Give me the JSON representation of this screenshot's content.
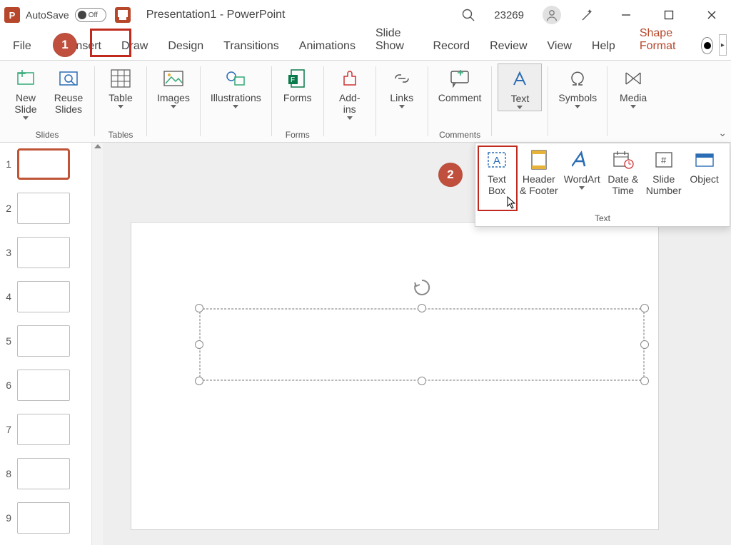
{
  "titlebar": {
    "autosave_label": "AutoSave",
    "autosave_state": "Off",
    "document_title": "Presentation1 - PowerPoint",
    "account": "23269"
  },
  "tabs": {
    "file": "File",
    "insert": "Insert",
    "draw": "Draw",
    "design": "Design",
    "transitions": "Transitions",
    "animations": "Animations",
    "slideshow": "Slide Show",
    "record": "Record",
    "review": "Review",
    "view": "View",
    "help": "Help",
    "shape_format": "Shape Format"
  },
  "ribbon": {
    "slides_group": "Slides",
    "new_slide": "New\nSlide",
    "reuse_slides": "Reuse\nSlides",
    "tables_group": "Tables",
    "table": "Table",
    "images": "Images",
    "illustrations": "Illustrations",
    "forms_group": "Forms",
    "forms": "Forms",
    "addins": "Add-\nins",
    "links": "Links",
    "comments_group": "Comments",
    "comment": "Comment",
    "text": "Text",
    "symbols": "Symbols",
    "media": "Media"
  },
  "text_panel": {
    "label": "Text",
    "text_box": "Text\nBox",
    "header_footer": "Header\n& Footer",
    "wordart": "WordArt",
    "date_time": "Date &\nTime",
    "slide_number": "Slide\nNumber",
    "object": "Object"
  },
  "thumbnails": {
    "items": [
      "1",
      "2",
      "3",
      "4",
      "5",
      "6",
      "7",
      "8",
      "9"
    ],
    "selected": 0
  },
  "annotations": {
    "step1": "1",
    "step2": "2"
  },
  "colors": {
    "accent": "#c0503d",
    "highlight": "#c02a1e"
  }
}
